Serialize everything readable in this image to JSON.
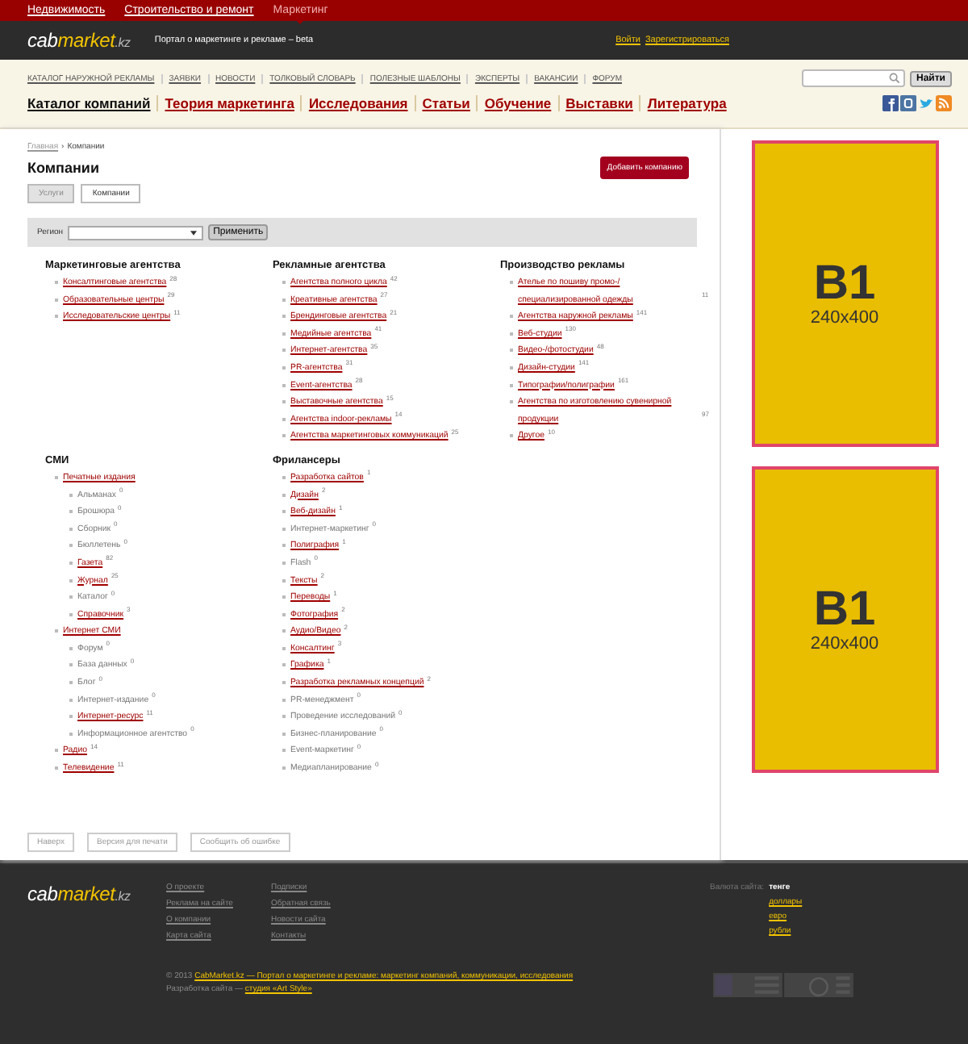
{
  "site_nav": [
    {
      "label": "Недвижимость",
      "selected": false
    },
    {
      "label": "Строительство и ремонт",
      "selected": false
    },
    {
      "label": "Маркетинг",
      "selected": true
    }
  ],
  "logo": {
    "part1": "cab",
    "part2": "market",
    "part3": ".kz"
  },
  "tagline": "Портал о маркетинге и рекламе – beta",
  "auth_links": [
    "Войти",
    "Зарегистрироваться"
  ],
  "secondary_nav": [
    "КАТАЛОГ НАРУЖНОЙ РЕКЛАМЫ",
    "ЗАЯВКИ",
    "НОВОСТИ",
    "ТОЛКОВЫЙ СЛОВАРЬ",
    "ПОЛЕЗНЫЕ ШАБЛОНЫ",
    "ЭКСПЕРТЫ",
    "ВАКАНСИИ",
    "ФОРУМ"
  ],
  "search": {
    "button": "Найти"
  },
  "main_nav": [
    {
      "label": "Каталог компаний",
      "selected": true
    },
    {
      "label": "Теория маркетинга",
      "selected": false
    },
    {
      "label": "Исследования",
      "selected": false
    },
    {
      "label": "Статьи",
      "selected": false
    },
    {
      "label": "Обучение",
      "selected": false
    },
    {
      "label": "Выставки",
      "selected": false
    },
    {
      "label": "Литература",
      "selected": false
    }
  ],
  "breadcrumbs": [
    "Главная",
    "›",
    "Компании"
  ],
  "page_title": "Компании",
  "add_button": "Добавить компанию",
  "tabs": [
    {
      "label": "Услуги",
      "selected": false
    },
    {
      "label": "Компании",
      "selected": true
    }
  ],
  "filter": {
    "label": "Регион",
    "button": "Применить"
  },
  "category_groups": [
    {
      "title": "Маркетинговые агентства",
      "items": [
        {
          "label": "Консалтинговые агентства",
          "count": "28",
          "linked": true
        },
        {
          "label": "Образовательные центры",
          "count": "29",
          "linked": true
        },
        {
          "label": "Исследовательские центры",
          "count": "11",
          "linked": true
        }
      ]
    },
    {
      "title": "Рекламные агентства",
      "items": [
        {
          "label": "Агентства полного цикла",
          "count": "42",
          "linked": true
        },
        {
          "label": "Креативные агентства",
          "count": "27",
          "linked": true
        },
        {
          "label": "Брендинговые агентства",
          "count": "21",
          "linked": true
        },
        {
          "label": "Медийные агентства",
          "count": "41",
          "linked": true
        },
        {
          "label": "Интернет-агентства",
          "count": "35",
          "linked": true
        },
        {
          "label": "PR-агентства",
          "count": "31",
          "linked": true
        },
        {
          "label": "Event-агентства",
          "count": "28",
          "linked": true
        },
        {
          "label": "Выставочные агентства",
          "count": "15",
          "linked": true
        },
        {
          "label": "Агентства indoor-рекламы",
          "count": "14",
          "linked": true
        },
        {
          "label": "Агентства маркетинговых коммуникаций",
          "count": "25",
          "linked": true
        }
      ]
    },
    {
      "title": "Производство рекламы",
      "items": [
        {
          "label": "Ателье по пошиву промо-/специализированной одежды",
          "count": "11",
          "linked": true
        },
        {
          "label": "Агентства наружной рекламы",
          "count": "141",
          "linked": true
        },
        {
          "label": "Веб-студии",
          "count": "130",
          "linked": true
        },
        {
          "label": "Видео-/фотостудии",
          "count": "48",
          "linked": true
        },
        {
          "label": "Дизайн-студии",
          "count": "141",
          "linked": true
        },
        {
          "label": "Типографии/полиграфии",
          "count": "161",
          "linked": true
        },
        {
          "label": "Агентства по изготовлению сувенирной продукции",
          "count": "97",
          "linked": true
        },
        {
          "label": "Другое",
          "count": "10",
          "linked": true
        }
      ]
    },
    {
      "title": "СМИ",
      "items": [
        {
          "label": "Печатные издания",
          "linked": true,
          "children": [
            {
              "label": "Альманах",
              "count": "0",
              "linked": false
            },
            {
              "label": "Брошюра",
              "count": "0",
              "linked": false
            },
            {
              "label": "Сборник",
              "count": "0",
              "linked": false
            },
            {
              "label": "Бюллетень",
              "count": "0",
              "linked": false
            },
            {
              "label": "Газета",
              "count": "82",
              "linked": true
            },
            {
              "label": "Журнал",
              "count": "25",
              "linked": true
            },
            {
              "label": "Каталог",
              "count": "0",
              "linked": false
            },
            {
              "label": "Справочник",
              "count": "3",
              "linked": true
            }
          ]
        },
        {
          "label": "Интернет СМИ",
          "linked": true,
          "children": [
            {
              "label": "Форум",
              "count": "0",
              "linked": false
            },
            {
              "label": "База данных",
              "count": "0",
              "linked": false
            },
            {
              "label": "Блог",
              "count": "0",
              "linked": false
            },
            {
              "label": "Интернет-издание",
              "count": "0",
              "linked": false
            },
            {
              "label": "Интернет-ресурс",
              "count": "11",
              "linked": true
            },
            {
              "label": "Информационное агентство",
              "count": "0",
              "linked": false
            }
          ]
        },
        {
          "label": "Радио",
          "count": "14",
          "linked": true
        },
        {
          "label": "Телевидение",
          "count": "11",
          "linked": true
        }
      ]
    },
    {
      "title": "Фрилансеры",
      "items": [
        {
          "label": "Разработка сайтов",
          "count": "1",
          "linked": true
        },
        {
          "label": "Дизайн",
          "count": "2",
          "linked": true
        },
        {
          "label": "Веб-дизайн",
          "count": "1",
          "linked": true
        },
        {
          "label": "Интернет-маркетинг",
          "count": "0",
          "linked": false
        },
        {
          "label": "Полиграфия",
          "count": "1",
          "linked": true
        },
        {
          "label": "Flash",
          "count": "0",
          "linked": false
        },
        {
          "label": "Тексты",
          "count": "2",
          "linked": true
        },
        {
          "label": "Переводы",
          "count": "1",
          "linked": true
        },
        {
          "label": "Фотография",
          "count": "2",
          "linked": true
        },
        {
          "label": "Аудио/Видео",
          "count": "2",
          "linked": true
        },
        {
          "label": "Консалтинг",
          "count": "3",
          "linked": true
        },
        {
          "label": "Графика",
          "count": "1",
          "linked": true
        },
        {
          "label": "Разработка рекламных концепций",
          "count": "2",
          "linked": true
        },
        {
          "label": "PR-менеджмент",
          "count": "0",
          "linked": false
        },
        {
          "label": "Проведение исследований",
          "count": "0",
          "linked": false
        },
        {
          "label": "Бизнес-планирование",
          "count": "0",
          "linked": false
        },
        {
          "label": "Event-маркетинг",
          "count": "0",
          "linked": false
        },
        {
          "label": "Медиапланирование",
          "count": "0",
          "linked": false
        }
      ]
    }
  ],
  "bottom_buttons": [
    "Наверх",
    "Версия для печати",
    "Сообщить об ошибке"
  ],
  "ads": [
    {
      "title": "B1",
      "size": "240x400"
    },
    {
      "title": "B1",
      "size": "240x400"
    }
  ],
  "footer": {
    "logo": {
      "part1": "cab",
      "part2": "market",
      "part3": ".kz"
    },
    "link_columns": [
      [
        "О проекте",
        "Реклама на сайте",
        "О компании",
        "Карта сайта"
      ],
      [
        "Подписки",
        "Обратная связь",
        "Новости сайта",
        "Контакты"
      ]
    ],
    "currency_label": "Валюта сайта:",
    "currencies": [
      {
        "label": "тенге",
        "selected": true
      },
      {
        "label": "доллары",
        "selected": false
      },
      {
        "label": "евро",
        "selected": false
      },
      {
        "label": "рубли",
        "selected": false
      }
    ],
    "copyright": "© 2013",
    "copyright_link": "CabMarket.kz — Портал о маркетинге и рекламе: маркетинг компаний, коммуникации, исследования",
    "developer_label": "Разработка сайта —",
    "developer_link": "студия «Art Style»"
  }
}
